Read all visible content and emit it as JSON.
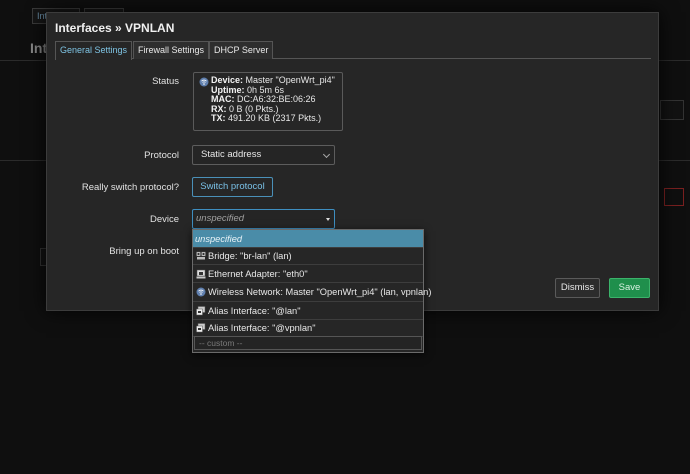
{
  "background": {
    "tabs": [
      "Int",
      "…"
    ],
    "title": "Inte"
  },
  "modal": {
    "title": "Interfaces » VPNLAN",
    "tabs": [
      {
        "label": "General Settings",
        "active": true
      },
      {
        "label": "Firewall Settings",
        "active": false
      },
      {
        "label": "DHCP Server",
        "active": false
      }
    ]
  },
  "form": {
    "status_label": "Status",
    "status": {
      "device_key": "Device:",
      "device_val": "Master \"OpenWrt_pi4\"",
      "uptime_key": "Uptime:",
      "uptime_val": "0h 5m 6s",
      "mac_key": "MAC:",
      "mac_val": "DC:A6:32:BE:06:26",
      "rx_key": "RX:",
      "rx_val": "0 B (0 Pkts.)",
      "tx_key": "TX:",
      "tx_val": "491.20 KB (2317 Pkts.)"
    },
    "protocol_label": "Protocol",
    "protocol_value": "Static address",
    "switch_label": "Really switch protocol?",
    "switch_button": "Switch protocol",
    "device_label": "Device",
    "device_placeholder": "unspecified",
    "bringup_label": "Bring up on boot"
  },
  "dropdown": {
    "items": [
      {
        "label": "unspecified",
        "icon": "none",
        "selected": true
      },
      {
        "label": "Bridge: \"br-lan\" (lan)",
        "icon": "bridge-icon",
        "selected": false
      },
      {
        "label": "Ethernet Adapter: \"eth0\"",
        "icon": "ethernet-icon",
        "selected": false
      },
      {
        "label": "Wireless Network: Master \"OpenWrt_pi4\" (lan, vpnlan)",
        "icon": "wireless-icon",
        "selected": false
      },
      {
        "label": "Alias Interface: \"@lan\"",
        "icon": "alias-icon",
        "selected": false
      },
      {
        "label": "Alias Interface: \"@vpnlan\"",
        "icon": "alias-icon",
        "selected": false
      }
    ],
    "custom_placeholder": "-- custom --"
  },
  "footer": {
    "dismiss": "Dismiss",
    "save": "Save"
  },
  "colors": {
    "accent": "#7fc4e4",
    "selected_row": "#4a8ca8",
    "save": "#1f8f4c"
  }
}
